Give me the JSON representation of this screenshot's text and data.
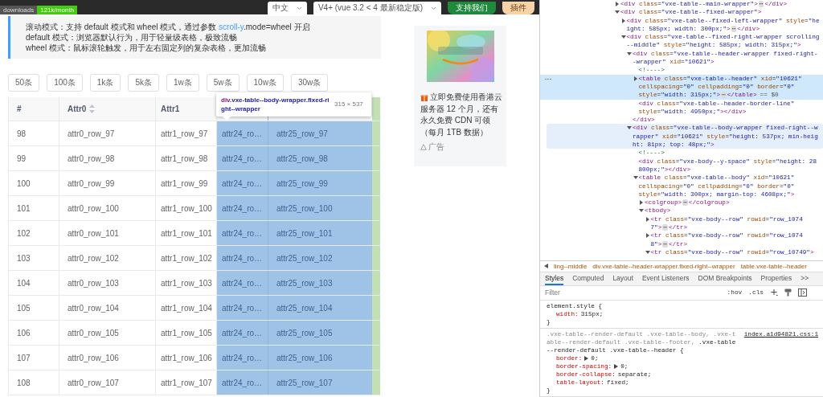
{
  "top_bar": {
    "badge": {
      "label": "downloads",
      "value": "121k/month"
    },
    "selects": [
      "中文",
      "V4+ (vue 3.2 < 4 最新稳定版)"
    ],
    "buttons": [
      {
        "label": "支持我们",
        "kind": "primary"
      },
      {
        "label": "插件",
        "kind": "plugin"
      }
    ]
  },
  "info": {
    "first_line": {
      "before": "滚动模式：支持 default 模式和 wheel 模式，通过参数 ",
      "link": "scroll-y",
      "after": ".mode=wheel 开启"
    },
    "lines": [
      "default 模式：浏览器默认行为，用于轻量级表格，极致流畅",
      "wheel 模式：鼠标滚轮触发，用于左右固定列的复杂表格，更加流畅"
    ]
  },
  "row_buttons": [
    "50条",
    "100条",
    "1k条",
    "5k条",
    "1w条",
    "5w条",
    "10w条",
    "30w条"
  ],
  "table": {
    "columns": [
      {
        "title": "#",
        "sortable": false,
        "highlighted": false
      },
      {
        "title": "Attr0",
        "sortable": true,
        "highlighted": false
      },
      {
        "title": "Attr1",
        "sortable": false,
        "highlighted": false
      },
      {
        "highlighted": true
      },
      {
        "highlighted": true
      }
    ],
    "rows": [
      [
        "98",
        "attr0_row_97",
        "attr1_row_97",
        "attr24_ro…",
        "attr25_row_97"
      ],
      [
        "99",
        "attr0_row_98",
        "attr1_row_98",
        "attr24_ro…",
        "attr25_row_98"
      ],
      [
        "100",
        "attr0_row_99",
        "attr1_row_99",
        "attr24_ro…",
        "attr25_row_99"
      ],
      [
        "101",
        "attr0_row_100",
        "attr1_row_100",
        "attr24_ro…",
        "attr25_row_100"
      ],
      [
        "102",
        "attr0_row_101",
        "attr1_row_101",
        "attr24_ro…",
        "attr25_row_101"
      ],
      [
        "103",
        "attr0_row_102",
        "attr1_row_102",
        "attr24_ro…",
        "attr25_row_102"
      ],
      [
        "104",
        "attr0_row_103",
        "attr1_row_103",
        "attr24_ro…",
        "attr25_row_103"
      ],
      [
        "105",
        "attr0_row_104",
        "attr1_row_104",
        "attr24_ro…",
        "attr25_row_104"
      ],
      [
        "106",
        "attr0_row_105",
        "attr1_row_105",
        "attr24_ro…",
        "attr25_row_105"
      ],
      [
        "107",
        "attr0_row_106",
        "attr1_row_106",
        "attr24_ro…",
        "attr25_row_106"
      ],
      [
        "108",
        "attr0_row_107",
        "attr1_row_107",
        "attr24_ro…",
        "attr25_row_107"
      ]
    ],
    "tooltip": {
      "tag": "div",
      "selector": ".vxe-table--body-wrapper.fixed-right--wrapper",
      "size": "315 × 537"
    }
  },
  "ad": {
    "text": "立即免费使用香港云服务器 12 个月，还有永久免费 CDN 可领（每月 1TB 数据）",
    "label": "广告"
  },
  "devtools": {
    "elements": [
      {
        "kind": "element",
        "open": "<div class=\"vxe-table--main-wrapper\">",
        "marker": "⋯",
        "close": "</div>",
        "expanded": false,
        "selected": false,
        "hovered": false
      },
      {
        "kind": "element",
        "open": "<div class=\"vxe-table--fixed-wrapper\">",
        "expanded": true,
        "selected": false,
        "hovered": false,
        "children": [
          {
            "kind": "element",
            "open": "<div class=\"vxe-table--fixed-left-wrapper\" style=\"height: 585px; width: 300px;\">",
            "marker": "⋯",
            "close": "</div>",
            "expanded": false,
            "selected": false,
            "hovered": false
          },
          {
            "kind": "element",
            "open": "<div class=\"vxe-table--fixed-right-wrapper scrolling--middle\" style=\"height: 585px; width: 315px;\">",
            "expanded": true,
            "selected": false,
            "hovered": false,
            "children": [
              {
                "kind": "element",
                "open": "<div class=\"vxe-table--header-wrapper fixed-right--wrapper\" xid=\"10621\">",
                "close": "</div>",
                "expanded": true,
                "selected": false,
                "hovered": false,
                "children": [
                  {
                    "kind": "comment",
                    "open": "<!---->",
                    "selected": false,
                    "hovered": false
                  },
                  {
                    "kind": "element",
                    "open": "<table class=\"vxe-table--header\" xid=\"10621\" cellspacing=\"0\" cellpadding=\"0\" border=\"0\" style=\"width: 315px;\">",
                    "marker": "⋯",
                    "close": "</table>",
                    "suffix": "== $0",
                    "expanded": false,
                    "selected": true,
                    "hovered": false
                  },
                  {
                    "kind": "leaf",
                    "open": "<div class=\"vxe-table--header-border-line\" style=\"width: 4950px;\"></div>",
                    "selected": false,
                    "hovered": false
                  }
                ]
              },
              {
                "kind": "element",
                "open": "<div class=\"vxe-table--body-wrapper fixed-right--wrapper\" xid=\"10621\" style=\"height: 537px; min-height: 81px; top: 48px;\">",
                "expanded": true,
                "selected": false,
                "hovered": true,
                "children": [
                  {
                    "kind": "comment",
                    "open": "<!---->",
                    "selected": false,
                    "hovered": false
                  },
                  {
                    "kind": "leaf",
                    "open": "<div class=\"vxe-body--y-space\" style=\"height: 28800px;\"></div>",
                    "selected": false,
                    "hovered": false
                  },
                  {
                    "kind": "element",
                    "open": "<table class=\"vxe-table--body\" xid=\"10621\" cellspacing=\"0\" cellpadding=\"0\" border=\"0\" style=\"width: 300px; margin-top: 4608px;\">",
                    "expanded": true,
                    "selected": false,
                    "hovered": false,
                    "children": [
                      {
                        "kind": "element",
                        "open": "<colgroup>",
                        "marker": "⋯",
                        "close": "</colgroup>",
                        "expanded": false,
                        "selected": false,
                        "hovered": false
                      },
                      {
                        "kind": "element",
                        "open": "<tbody>",
                        "expanded": true,
                        "selected": false,
                        "hovered": false,
                        "children": [
                          {
                            "kind": "element",
                            "open": "<tr class=\"vxe-body--row\" rowid=\"row_10747\">",
                            "marker": "⋯",
                            "close": "</tr>",
                            "expanded": false,
                            "selected": false,
                            "hovered": false
                          },
                          {
                            "kind": "element",
                            "open": "<tr class=\"vxe-body--row\" rowid=\"row_10748\">",
                            "marker": "⋯",
                            "close": "</tr>",
                            "expanded": false,
                            "selected": false,
                            "hovered": false
                          },
                          {
                            "kind": "element",
                            "open": "<tr class=\"vxe-body--row\" rowid=\"row_10749\">",
                            "expanded": true,
                            "selected": false,
                            "hovered": false
                          }
                        ]
                      }
                    ]
                  }
                ]
              }
            ]
          }
        ]
      }
    ],
    "breadcrumb": [
      "ling--middle",
      "div.vxe-table--header-wrapper.fixed-right--wrapper",
      "table.vxe-table--header"
    ],
    "tabs": [
      {
        "label": "Styles",
        "selected": true
      },
      {
        "label": "Computed",
        "selected": false
      },
      {
        "label": "Layout",
        "selected": false
      },
      {
        "label": "Event Listeners",
        "selected": false
      },
      {
        "label": "DOM Breakpoints",
        "selected": false
      },
      {
        "label": "Properties",
        "selected": false
      },
      {
        "label": ">>",
        "selected": false
      }
    ],
    "filter": {
      "placeholder": "Filter",
      "toggles": [
        ":hov",
        ".cls"
      ]
    },
    "rules": [
      {
        "selector": "element.style {",
        "properties": [
          {
            "name": "width:",
            "value": "315px;",
            "expandable": false
          }
        ],
        "close": "}"
      },
      {
        "selector_dim": ".vxe-table--render-default .vxe-table--body, .vxe-table--render-default .vxe-table--footer, ",
        "selector": ".vxe-table--render-default .vxe-table--header {",
        "source": "index.a1d94821.css:1",
        "properties": [
          {
            "name": "border:",
            "value": "0;",
            "expandable": true
          },
          {
            "name": "border-spacing:",
            "value": "0;",
            "expandable": true
          },
          {
            "name": "border-collapse:",
            "value": "separate;",
            "expandable": false
          },
          {
            "name": "table-layout:",
            "value": "fixed;",
            "expandable": false
          }
        ],
        "close": "}"
      }
    ]
  }
}
